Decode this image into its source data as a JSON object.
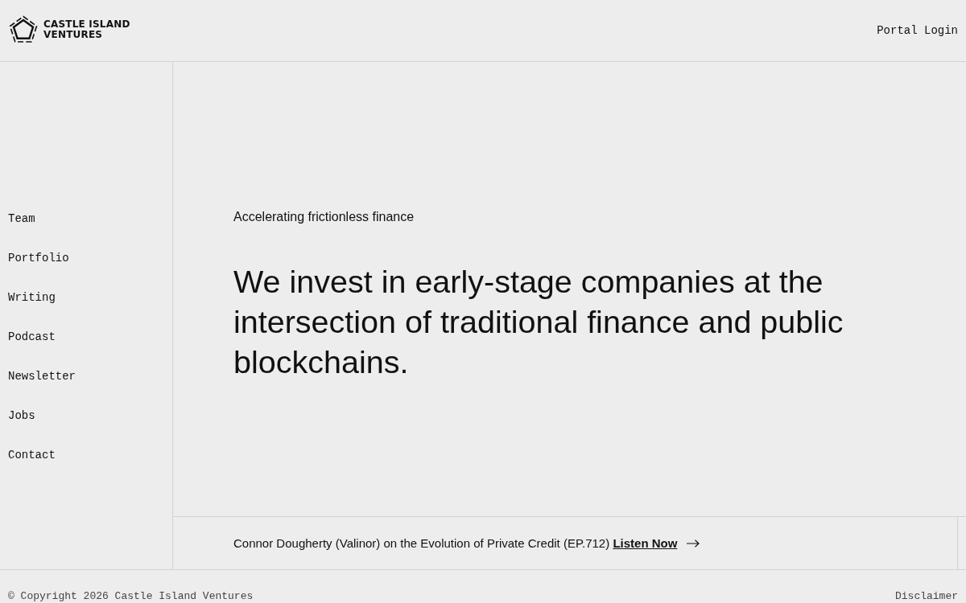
{
  "header": {
    "logo": {
      "line_1": "CASTLE ISLAND",
      "line_2": "VENTURES"
    },
    "portal_link": "Portal Login"
  },
  "sidebar": {
    "items": [
      {
        "label": "Team"
      },
      {
        "label": "Portfolio"
      },
      {
        "label": "Writing"
      },
      {
        "label": "Podcast"
      },
      {
        "label": "Newsletter"
      },
      {
        "label": "Jobs"
      },
      {
        "label": "Contact"
      }
    ]
  },
  "hero": {
    "tagline": "Accelerating frictionless finance",
    "headline": "We invest in early-stage companies at the intersection of traditional finance and public blockchains."
  },
  "banner": {
    "text": "Connor Dougherty (Valinor) on the Evolution of Private Credit (EP.712)",
    "link": "Listen Now"
  },
  "footer": {
    "copyright": "© Copyright 2026 Castle Island Ventures",
    "disclaimer": "Disclaimer"
  }
}
